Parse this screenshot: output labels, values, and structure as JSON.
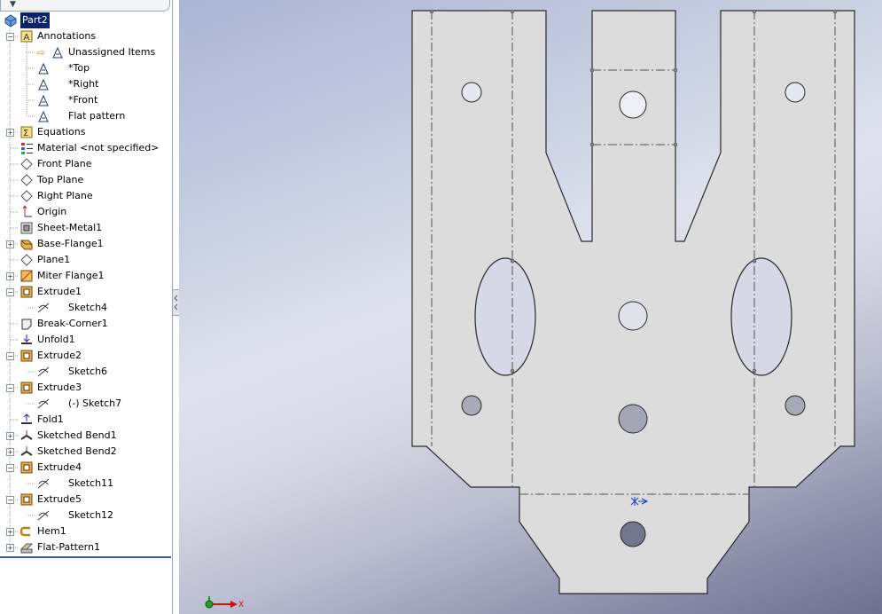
{
  "feature_tree": {
    "root": "Part2",
    "items": [
      {
        "label": "Annotations",
        "icon": "annotations-icon",
        "expander": "−"
      },
      {
        "label": "Unassigned Items",
        "icon": "annotation-view-icon",
        "expander": ""
      },
      {
        "label": "*Top",
        "icon": "annotation-view-icon",
        "expander": ""
      },
      {
        "label": "*Right",
        "icon": "annotation-view-icon",
        "expander": ""
      },
      {
        "label": "*Front",
        "icon": "annotation-view-icon",
        "expander": ""
      },
      {
        "label": "Flat pattern",
        "icon": "annotation-view-icon",
        "expander": ""
      },
      {
        "label": "Equations",
        "icon": "equations-icon",
        "expander": "+"
      },
      {
        "label": "Material <not specified>",
        "icon": "material-icon",
        "expander": ""
      },
      {
        "label": "Front Plane",
        "icon": "plane-icon",
        "expander": ""
      },
      {
        "label": "Top Plane",
        "icon": "plane-icon",
        "expander": ""
      },
      {
        "label": "Right Plane",
        "icon": "plane-icon",
        "expander": ""
      },
      {
        "label": "Origin",
        "icon": "origin-icon",
        "expander": ""
      },
      {
        "label": "Sheet-Metal1",
        "icon": "sheet-metal-icon",
        "expander": ""
      },
      {
        "label": "Base-Flange1",
        "icon": "base-flange-icon",
        "expander": "+"
      },
      {
        "label": "Plane1",
        "icon": "plane-icon",
        "expander": ""
      },
      {
        "label": "Miter Flange1",
        "icon": "miter-flange-icon",
        "expander": "+"
      },
      {
        "label": "Extrude1",
        "icon": "extrude-icon",
        "expander": "−"
      },
      {
        "label": "Sketch4",
        "icon": "sketch-icon",
        "expander": ""
      },
      {
        "label": "Break-Corner1",
        "icon": "break-corner-icon",
        "expander": ""
      },
      {
        "label": "Unfold1",
        "icon": "unfold-icon",
        "expander": ""
      },
      {
        "label": "Extrude2",
        "icon": "extrude-icon",
        "expander": "−"
      },
      {
        "label": "Sketch6",
        "icon": "sketch-icon",
        "expander": ""
      },
      {
        "label": "Extrude3",
        "icon": "extrude-icon",
        "expander": "−"
      },
      {
        "label": "(-) Sketch7",
        "icon": "sketch-icon",
        "expander": ""
      },
      {
        "label": "Fold1",
        "icon": "fold-icon",
        "expander": ""
      },
      {
        "label": "Sketched Bend1",
        "icon": "sketched-bend-icon",
        "expander": "+"
      },
      {
        "label": "Sketched Bend2",
        "icon": "sketched-bend-icon",
        "expander": "+"
      },
      {
        "label": "Extrude4",
        "icon": "extrude-icon",
        "expander": "−"
      },
      {
        "label": "Sketch11",
        "icon": "sketch-icon",
        "expander": ""
      },
      {
        "label": "Extrude5",
        "icon": "extrude-icon",
        "expander": "−"
      },
      {
        "label": "Sketch12",
        "icon": "sketch-icon",
        "expander": ""
      },
      {
        "label": "Hem1",
        "icon": "hem-icon",
        "expander": "+"
      },
      {
        "label": "Flat-Pattern1",
        "icon": "flat-pattern-icon",
        "expander": "+"
      }
    ]
  },
  "triad": {
    "x_label": "X"
  },
  "colors": {
    "part_face": "#dcdcdc",
    "edge": "#2a2a2a",
    "bend_line": "#555555",
    "selection": "#0a246a"
  }
}
